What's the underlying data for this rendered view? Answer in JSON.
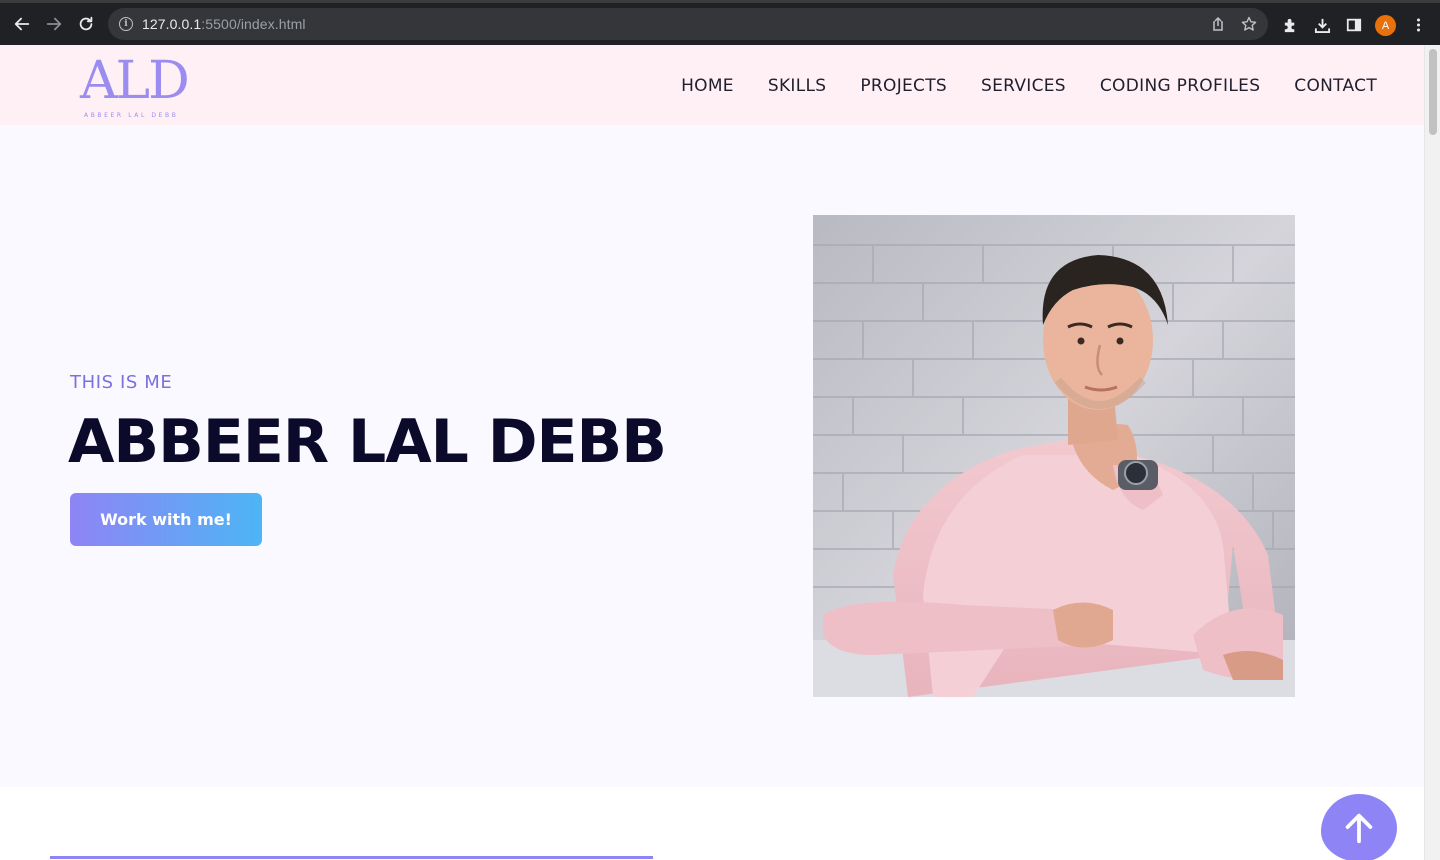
{
  "browser": {
    "url_host": "127.0.0.1",
    "url_rest": ":5500/index.html",
    "profile_initial": "A"
  },
  "header": {
    "logo_mark": "ALD",
    "logo_sub": "ABBEER LAL DEBB",
    "nav": [
      "HOME",
      "SKILLS",
      "PROJECTS",
      "SERVICES",
      "CODING PROFILES",
      "CONTACT"
    ]
  },
  "hero": {
    "eyebrow": "THIS IS ME",
    "name": "ABBEER LAL DEBB",
    "cta_label": "Work with me!"
  },
  "colors": {
    "accent": "#8f84f5",
    "accent_blue": "#4db5f5",
    "header_bg": "#fff0f5",
    "hero_bg": "#faf9ff",
    "heading": "#0c0a2b"
  },
  "icons": {
    "back_to_top": "arrow-up-icon",
    "portrait": "portrait-photo"
  }
}
